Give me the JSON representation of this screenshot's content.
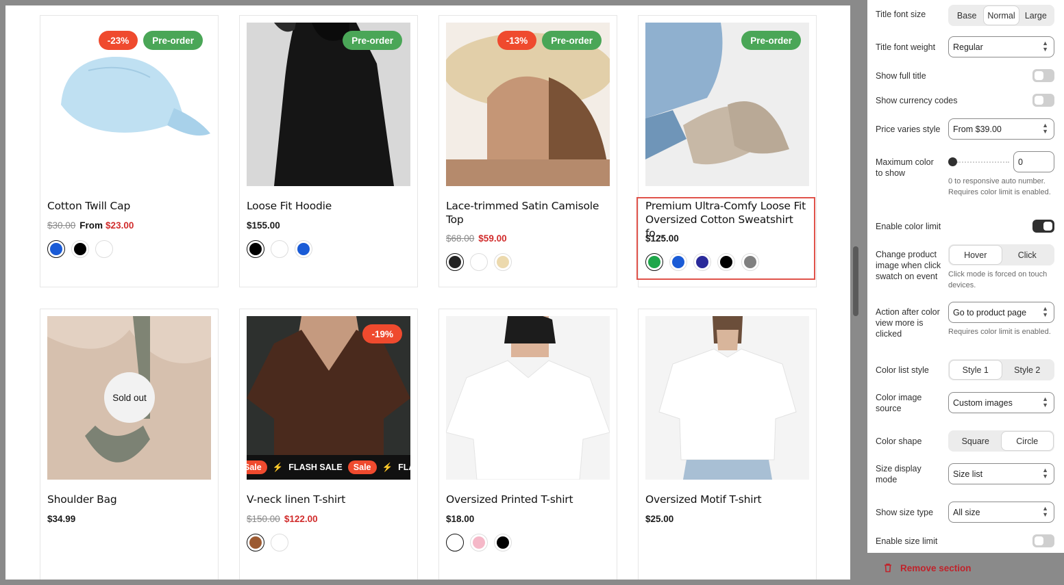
{
  "products": [
    {
      "title": "Cotton Twill Cap",
      "old_price": "$30.00",
      "from": "From",
      "price": "$23.00",
      "badges": [
        "-23%",
        "Pre-order"
      ],
      "swatches": [
        "#1a5bd6",
        "#000000",
        "#ffffff"
      ]
    },
    {
      "title": "Loose Fit Hoodie",
      "price": "$155.00",
      "badges": [
        "Pre-order"
      ],
      "swatches": [
        "#000000",
        "#ffffff",
        "#1a5bd6"
      ]
    },
    {
      "title": "Lace-trimmed Satin Camisole Top",
      "old_price": "$68.00",
      "price": "$59.00",
      "badges": [
        "-13%",
        "Pre-order"
      ],
      "swatches": [
        "#222222",
        "#ffffff",
        "#ecd9ad"
      ]
    },
    {
      "title": "Premium Ultra-Comfy Loose Fit Oversized Cotton Sweatshirt fo...",
      "price": "$125.00",
      "badges": [
        "Pre-order"
      ],
      "swatches": [
        "#1ea64a",
        "#1a5bd6",
        "#2a2a9a",
        "#000000",
        "#808080"
      ]
    },
    {
      "title": "Shoulder Bag",
      "price": "$34.99",
      "sold_out": "Sold out",
      "swatches": []
    },
    {
      "title": "V-neck linen T-shirt",
      "old_price": "$150.00",
      "price": "$122.00",
      "badges": [
        "-19%"
      ],
      "flash": {
        "pill": "Sale",
        "text": "FLASH SALE",
        "tail": "FLAS"
      },
      "swatches": [
        "#9c5a31",
        "#ffffff"
      ]
    },
    {
      "title": "Oversized Printed T-shirt",
      "price": "$18.00",
      "swatches": [
        "#ffffff",
        "#f5b8c8",
        "#000000"
      ]
    },
    {
      "title": "Oversized Motif T-shirt",
      "price": "$25.00",
      "swatches": []
    }
  ],
  "settings": {
    "title_font_size": {
      "label": "Title font size",
      "options": [
        "Base",
        "Normal",
        "Large"
      ],
      "selected": "Normal"
    },
    "title_font_weight": {
      "label": "Title font weight",
      "value": "Regular"
    },
    "show_full_title": {
      "label": "Show full title",
      "on": false
    },
    "show_currency_codes": {
      "label": "Show currency codes",
      "on": false
    },
    "price_varies_style": {
      "label": "Price varies style",
      "value": "From $39.00"
    },
    "max_color": {
      "label": "Maximum color to show",
      "value": "0",
      "help": "0 to responsive auto number. Requires color limit is enabled."
    },
    "enable_color_limit": {
      "label": "Enable color limit",
      "on": true
    },
    "change_image": {
      "label": "Change product image when click swatch on event",
      "options": [
        "Hover",
        "Click"
      ],
      "selected": "Hover",
      "help": "Click mode is forced on touch devices."
    },
    "action_after_color": {
      "label": "Action after color view more is clicked",
      "value": "Go to product page",
      "help": "Requires color limit is enabled."
    },
    "color_list_style": {
      "label": "Color list style",
      "options": [
        "Style 1",
        "Style 2"
      ],
      "selected": "Style 1"
    },
    "color_image_source": {
      "label": "Color image source",
      "value": "Custom images"
    },
    "color_shape": {
      "label": "Color shape",
      "options": [
        "Square",
        "Circle"
      ],
      "selected": "Circle"
    },
    "size_display_mode": {
      "label": "Size display mode",
      "value": "Size list"
    },
    "show_size_type": {
      "label": "Show size type",
      "value": "All size"
    },
    "enable_size_limit": {
      "label": "Enable size limit",
      "on": false
    }
  },
  "remove_section": "Remove section",
  "colors": {
    "sale": "#d12c2c",
    "badge_sale": "#ef4a2e",
    "badge_pre": "#4aa657",
    "remove": "#c0232b",
    "highlight": "#e0524a"
  }
}
